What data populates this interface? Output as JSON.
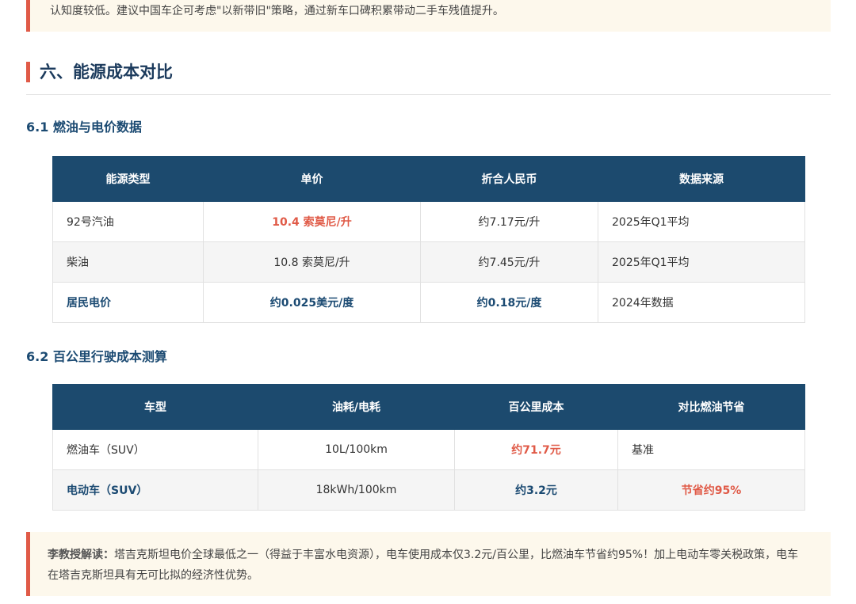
{
  "top_callout": {
    "text": "认知度较低。建议中国车企可考虑\"以新带旧\"策略，通过新车口碑积累带动二手车残值提升。"
  },
  "section": {
    "title": "六、能源成本对比"
  },
  "sub1": {
    "title": "6.1 燃油与电价数据",
    "headers": [
      "能源类型",
      "单价",
      "折合人民币",
      "数据来源"
    ],
    "rows": [
      [
        "92号汽油",
        "10.4 索莫尼/升",
        "约7.17元/升",
        "2025年Q1平均"
      ],
      [
        "柴油",
        "10.8 索莫尼/升",
        "约7.45元/升",
        "2025年Q1平均"
      ],
      [
        "居民电价",
        "约0.025美元/度",
        "约0.18元/度",
        "2024年数据"
      ]
    ]
  },
  "sub2": {
    "title": "6.2 百公里行驶成本测算",
    "headers": [
      "车型",
      "油耗/电耗",
      "百公里成本",
      "对比燃油节省"
    ],
    "rows": [
      [
        "燃油车（SUV）",
        "10L/100km",
        "约71.7元",
        "基准"
      ],
      [
        "电动车（SUV）",
        "18kWh/100km",
        "约3.2元",
        "节省约95%"
      ]
    ]
  },
  "bottom_callout": {
    "label": "李教授解读：",
    "text": "塔吉克斯坦电价全球最低之一（得益于丰富水电资源），电车使用成本仅3.2元/百公里，比燃油车节省约95%！加上电动车零关税政策，电车在塔吉克斯坦具有无可比拟的经济性优势。"
  },
  "colors": {
    "accent": "#e05a47",
    "header_bg": "#1c4a6e",
    "heading": "#1b3a5c",
    "callout_bg": "#fdf8ec"
  }
}
